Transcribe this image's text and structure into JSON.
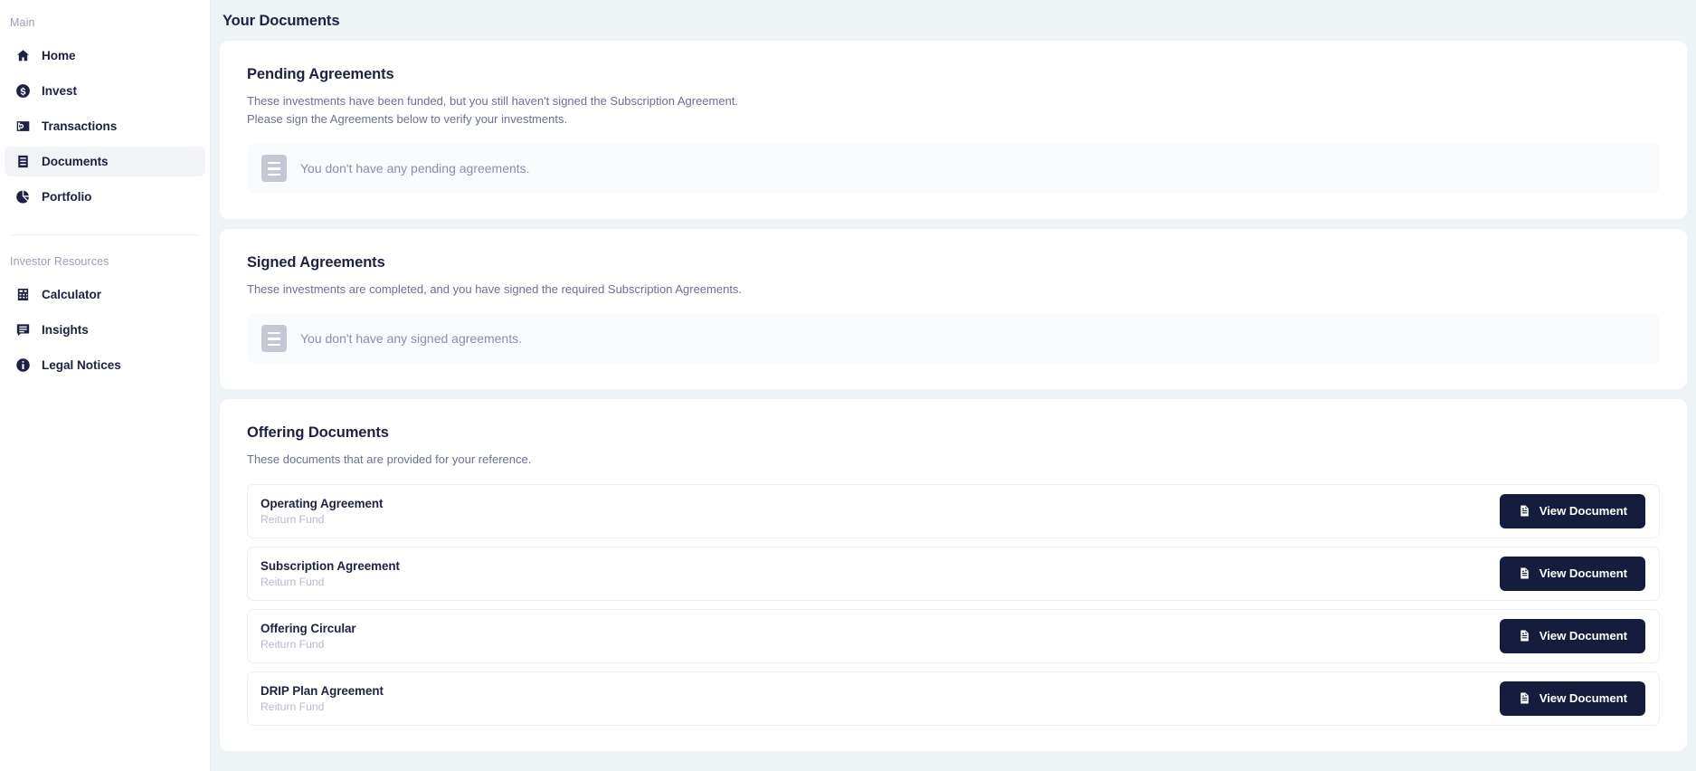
{
  "sidebar": {
    "sections": [
      {
        "label": "Main",
        "items": [
          {
            "label": "Home",
            "icon": "home-icon",
            "active": false
          },
          {
            "label": "Invest",
            "icon": "dollar-circle-icon",
            "active": false
          },
          {
            "label": "Transactions",
            "icon": "transactions-icon",
            "active": false
          },
          {
            "label": "Documents",
            "icon": "documents-icon",
            "active": true
          },
          {
            "label": "Portfolio",
            "icon": "pie-chart-icon",
            "active": false
          }
        ]
      },
      {
        "label": "Investor Resources",
        "items": [
          {
            "label": "Calculator",
            "icon": "calculator-icon",
            "active": false
          },
          {
            "label": "Insights",
            "icon": "chat-icon",
            "active": false
          },
          {
            "label": "Legal Notices",
            "icon": "info-icon",
            "active": false
          }
        ]
      }
    ]
  },
  "header": {
    "title": "Your Documents"
  },
  "pending_agreements": {
    "title": "Pending Agreements",
    "description_line1": "These investments have been funded, but you still haven't signed the Subscription Agreement.",
    "description_line2": "Please sign the Agreements below to verify your investments.",
    "empty_text": "You don't have any pending agreements.",
    "empty_icon": "document-lines-icon"
  },
  "signed_agreements": {
    "title": "Signed Agreements",
    "description_line1": "These investments are completed, and you have signed the required Subscription Agreements.",
    "empty_text": "You don't have any signed agreements.",
    "empty_icon": "document-lines-icon"
  },
  "offering_documents": {
    "title": "Offering Documents",
    "description_line1": "These documents that are provided for your reference.",
    "button_label": "View Document",
    "button_icon": "document-icon",
    "rows": [
      {
        "name": "Operating Agreement",
        "fund": "Reiturn Fund"
      },
      {
        "name": "Subscription Agreement",
        "fund": "Reiturn Fund"
      },
      {
        "name": "Offering Circular",
        "fund": "Reiturn Fund"
      },
      {
        "name": "DRIP Plan Agreement",
        "fund": "Reiturn Fund"
      }
    ]
  },
  "colors": {
    "page_background": "#eef3f6",
    "card_background": "#ffffff",
    "brand_navy": "#161c3d",
    "text_primary": "#1e2144",
    "text_muted": "#6b7190",
    "text_faint": "#b6bbc9",
    "empty_icon": "#c3c8d4",
    "active_nav": "#f1f3f6"
  }
}
